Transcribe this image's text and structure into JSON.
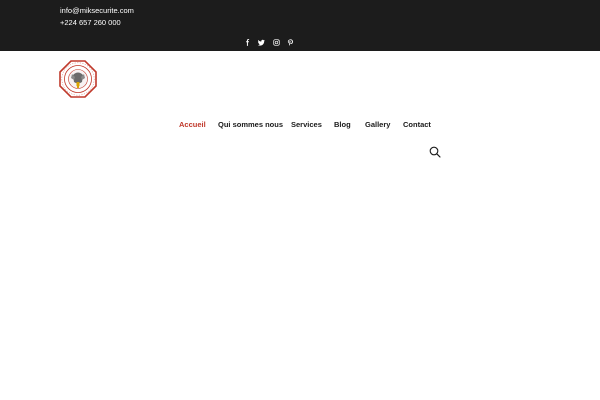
{
  "topbar": {
    "email": "info@miksecurite.com",
    "phone": "+224 657 260 000",
    "social_icons": [
      "facebook-icon",
      "twitter-icon",
      "instagram-icon",
      "pinterest-icon"
    ]
  },
  "logo": {
    "icon": "company-seal-logo",
    "colors": {
      "ring": "#c0392b",
      "center": "#d9a300"
    }
  },
  "nav": {
    "items": [
      {
        "label": "Accueil",
        "active": true
      },
      {
        "label": "Qui sommes nous",
        "active": false
      },
      {
        "label": "Services",
        "active": false
      },
      {
        "label": "Blog",
        "active": false
      },
      {
        "label": "Gallery",
        "active": false
      },
      {
        "label": "Contact",
        "active": false
      }
    ]
  },
  "search": {
    "icon": "search-icon"
  },
  "colors": {
    "topbar_bg": "#1c1c1c",
    "accent": "#c0392b",
    "text": "#1a1a1a"
  }
}
